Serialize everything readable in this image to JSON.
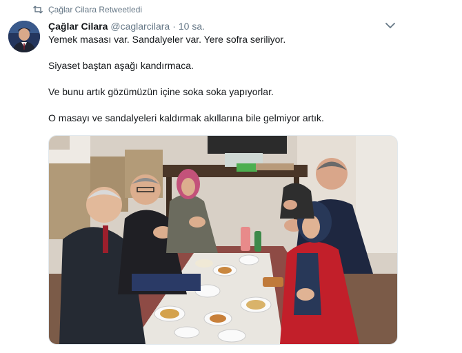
{
  "retweet": {
    "label": "Çağlar Cilara Retweetledi"
  },
  "tweet": {
    "display_name": "Çağlar Cilara",
    "handle": "@caglarcilara",
    "separator": "·",
    "time": "10 sa.",
    "paragraphs": [
      "Yemek masası var. Sandalyeler var. Yere sofra seriliyor.",
      "Siyaset baştan aşağı kandırmaca.",
      "Ve bunu artık gözümüzün içine soka soka yapıyorlar.",
      "O masayı ve sandalyeleri kaldırmak akıllarına bile gelmiyor artık."
    ]
  },
  "icons": {
    "retweet": "retweet-icon",
    "more": "chevron-down-icon",
    "avatar": "avatar"
  },
  "colors": {
    "text": "#14171a",
    "muted": "#657786",
    "border": "#e1e8ed"
  }
}
